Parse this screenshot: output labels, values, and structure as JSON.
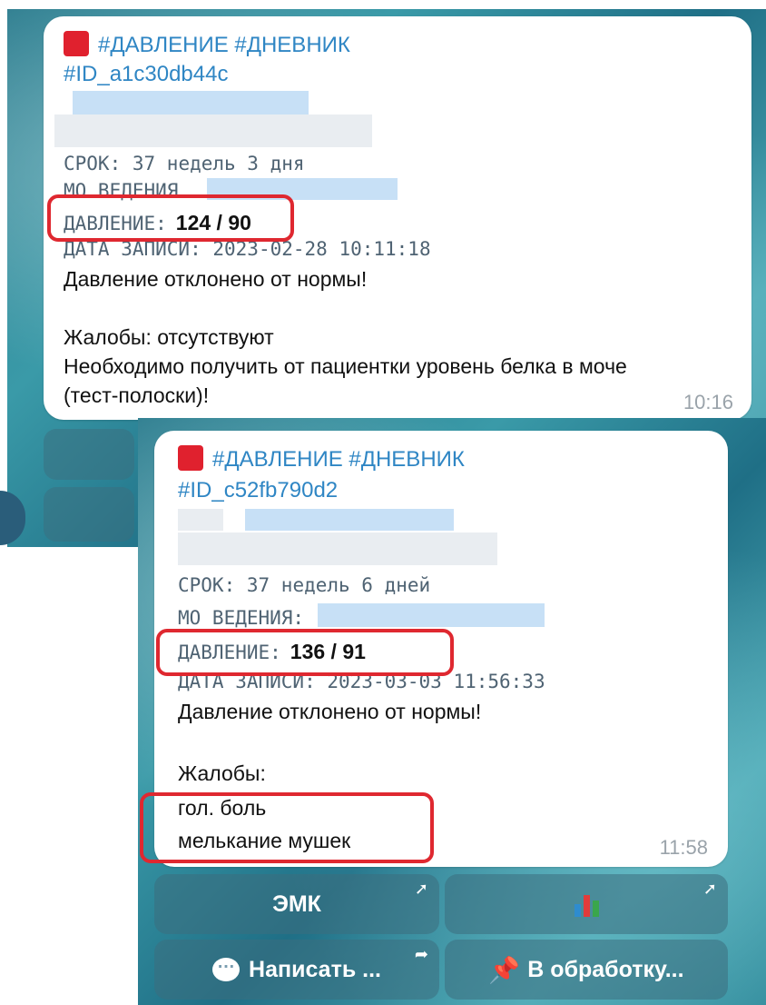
{
  "messages": [
    {
      "tags": "#ДАВЛЕНИЕ #ДНЕВНИК",
      "id_tag": "#ID_a1c30db44c",
      "term_label": "СРОК:",
      "term_value": "37 недель 3 дня",
      "mo_label": "МО ВЕДЕНИЯ",
      "pressure_label": "ДАВЛЕНИЕ:",
      "pressure_value": "124 / 90",
      "date_label": "ДАТА ЗАПИСИ:",
      "date_value": "2023-02-28 10:11:18",
      "warning": "Давление отклонено от нормы!",
      "complaints_line": "Жалобы: отсутствуют",
      "extra_line_1": "Необходимо получить от пациентки уровень белка в моче",
      "extra_line_2": "(тест-полоски)!",
      "time": "10:16"
    },
    {
      "tags": "#ДАВЛЕНИЕ #ДНЕВНИК",
      "id_tag": "#ID_c52fb790d2",
      "term_label": "СРОК:",
      "term_value": "37 недель 6 дней",
      "mo_label": "МО ВЕДЕНИЯ:",
      "pressure_label": "ДАВЛЕНИЕ:",
      "pressure_value": "136 / 91",
      "date_label": "ДАТА ЗАПИСИ:",
      "date_value": "2023-03-03 11:56:33",
      "warning": "Давление отклонено от нормы!",
      "complaints_line": "Жалобы:",
      "symptom_1": "гол. боль",
      "symptom_2": "мелькание мушек",
      "time": "11:58"
    }
  ],
  "keyboard": {
    "emk_label": "ЭМК",
    "chart_icon": "bar-chart-icon",
    "write_label": "Написать ...",
    "process_label": "В обработку...",
    "write_icon": "speech-bubble-icon",
    "process_icon": "pushpin-icon",
    "open_icon": "arrow-up-right-icon"
  },
  "colors": {
    "tag": "#2f86c4",
    "highlight": "#df2830",
    "square": "#e0212e"
  }
}
